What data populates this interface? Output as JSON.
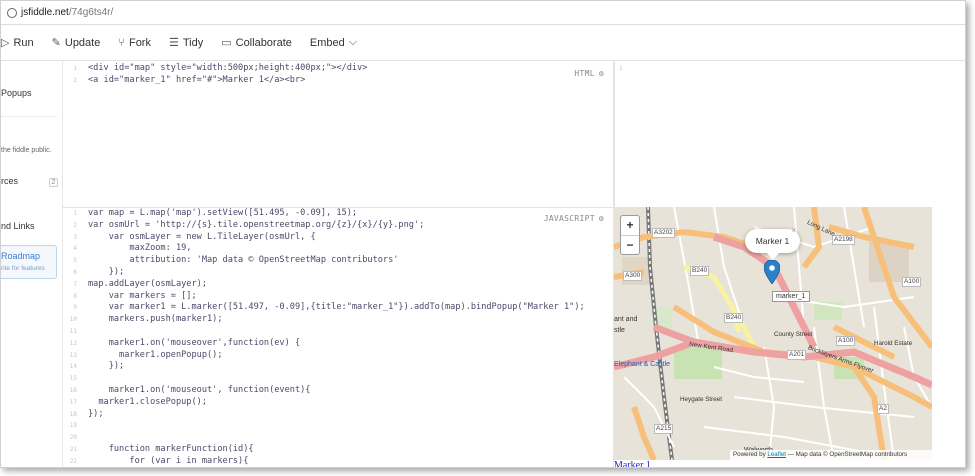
{
  "url": {
    "host": "jsfiddle.net",
    "path": "/74g6ts4r/"
  },
  "toolbar": {
    "run": "Run",
    "update": "Update",
    "fork": "Fork",
    "tidy": "Tidy",
    "collaborate": "Collaborate",
    "embed": "Embed"
  },
  "sidebar": {
    "popups": "Popups",
    "public_note": "the fiddle public.",
    "resources": "rces",
    "resources_count": "2",
    "links": "nd Links",
    "roadmap": "Roadmap",
    "roadmap_sub": "rite for features"
  },
  "panels": {
    "html_label": "HTML",
    "js_label": "JAVASCRIPT"
  },
  "html_code": [
    "<div id=\"map\" style=\"width:500px;height:400px;\"></div>",
    "<a id=\"marker_1\" href=\"#\">Marker 1</a><br>"
  ],
  "js_code": [
    "var map = L.map('map').setView([51.495, -0.09], 15);",
    "var osmUrl = 'http://{s}.tile.openstreetmap.org/{z}/{x}/{y}.png';",
    "    var osmLayer = new L.TileLayer(osmUrl, {",
    "        maxZoom: 19,",
    "        attribution: 'Map data © OpenStreetMap contributors'",
    "    });",
    "map.addLayer(osmLayer);",
    "    var markers = [];",
    "    var marker1 = L.marker([51.497, -0.09],{title:\"marker_1\"}).addTo(map).bindPopup(\"Marker 1\");",
    "    markers.push(marker1);",
    "",
    "    marker1.on('mouseover',function(ev) {",
    "      marker1.openPopup();",
    "    });",
    "",
    "    marker1.on('mouseout', function(event){",
    "  marker1.closePopup();",
    "});",
    "",
    "",
    "    function markerFunction(id){",
    "        for (var i in markers){"
  ],
  "map": {
    "zoom_in": "+",
    "zoom_out": "−",
    "popup_text": "Marker 1",
    "popup_close": "×",
    "tooltip": "marker_1",
    "attribution_prefix": "Powered by ",
    "attribution_link": "Leaflet",
    "attribution_suffix": " — Map data © OpenStreetMap contributors",
    "labels": {
      "a3202": "A3202",
      "a300": "A300",
      "b240a": "B240",
      "b240b": "B240",
      "a2198": "A2198",
      "a100a": "A100",
      "a100b": "A100",
      "a201": "A201",
      "a2": "A2",
      "a215": "A215",
      "long_lane": "Long Lane",
      "new_kent": "New Kent Road",
      "bricklayers": "Bricklayers Arms Flyover",
      "elephant": "Elephant & Castle",
      "harold": "Harold Estate",
      "heygate": "Heygate Street",
      "county": "County Street",
      "walworth": "Walworth",
      "sant_and": "ant and",
      "stle": "stle"
    },
    "marker_color": "#2a81cb"
  },
  "result_link": "Marker 1"
}
